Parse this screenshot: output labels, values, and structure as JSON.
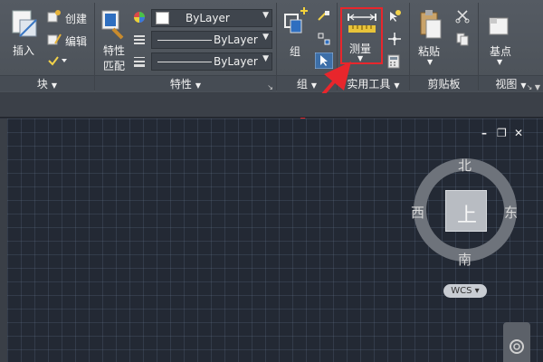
{
  "ribbon": {
    "block": {
      "insert_label": "插入",
      "create_label": "创建",
      "edit_label": "编辑",
      "title": "块"
    },
    "properties": {
      "match_label_line1": "特性",
      "match_label_line2": "匹配",
      "color_value": "ByLayer",
      "linetype_value": "ByLayer",
      "lineweight_value": "ByLayer",
      "title": "特性"
    },
    "group": {
      "group_label": "组",
      "title": "组"
    },
    "utilities": {
      "measure_label": "测量",
      "title": "实用工具"
    },
    "clipboard": {
      "paste_label": "粘贴",
      "title": "剪贴板"
    },
    "view": {
      "base_label": "基点",
      "title": "视图"
    }
  },
  "viewcube": {
    "north": "北",
    "south": "南",
    "east": "东",
    "west": "西",
    "face": "上",
    "wcs": "WCS"
  },
  "colors": {
    "highlight": "#e8262c",
    "ribbon_bg": "#50565e",
    "canvas_bg": "#232934"
  }
}
